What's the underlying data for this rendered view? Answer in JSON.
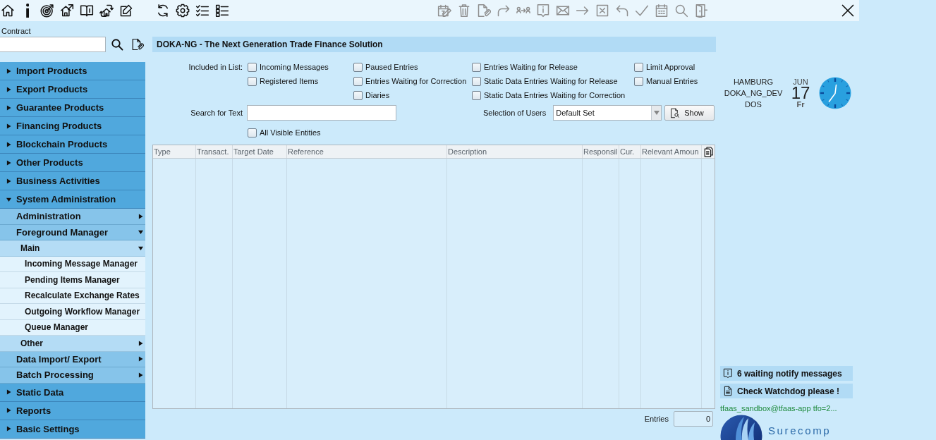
{
  "toolbar": {
    "groups": [
      {
        "buttons": [
          {
            "kind": "home",
            "disabled": false
          },
          {
            "kind": "info",
            "disabled": false
          },
          {
            "kind": "target",
            "disabled": false
          },
          {
            "kind": "export",
            "disabled": false
          },
          {
            "kind": "book",
            "disabled": false
          },
          {
            "kind": "exchange",
            "disabled": false
          },
          {
            "kind": "edit",
            "disabled": false
          }
        ]
      },
      {
        "buttons": [
          {
            "kind": "refresh",
            "disabled": false
          },
          {
            "kind": "settings",
            "disabled": false
          },
          {
            "kind": "checklist",
            "disabled": false
          },
          {
            "kind": "list",
            "disabled": false
          }
        ]
      },
      {
        "buttons": [
          {
            "kind": "diary",
            "disabled": true
          },
          {
            "kind": "delete",
            "disabled": true
          },
          {
            "kind": "attach",
            "disabled": true
          },
          {
            "kind": "forward",
            "disabled": true
          },
          {
            "kind": "transfer",
            "disabled": true
          },
          {
            "kind": "note",
            "disabled": true
          },
          {
            "kind": "mail",
            "disabled": true
          },
          {
            "kind": "send",
            "disabled": true
          },
          {
            "kind": "cancel",
            "disabled": true
          },
          {
            "kind": "reply",
            "disabled": true
          },
          {
            "kind": "approve",
            "disabled": true
          },
          {
            "kind": "calendar",
            "disabled": true
          },
          {
            "kind": "search",
            "disabled": true
          },
          {
            "kind": "exit",
            "disabled": true
          }
        ]
      }
    ],
    "close": {
      "kind": "close",
      "disabled": false
    }
  },
  "contract": {
    "label": "Contract"
  },
  "menu": [
    {
      "label": "Import Products",
      "expanded": false
    },
    {
      "label": "Export Products",
      "expanded": false
    },
    {
      "label": "Guarantee Products",
      "expanded": false
    },
    {
      "label": "Financing Products",
      "expanded": false
    },
    {
      "label": "Blockchain Products",
      "expanded": false
    },
    {
      "label": "Other Products",
      "expanded": false
    },
    {
      "label": "Business Activities",
      "expanded": false
    },
    {
      "label": "System Administration",
      "expanded": true,
      "children": [
        {
          "label": "Administration",
          "expanded": false
        },
        {
          "label": "Foreground Manager",
          "expanded": true,
          "children": [
            {
              "label": "Main",
              "expanded": true,
              "children": [
                {
                  "label": "Incoming Message Manager"
                },
                {
                  "label": "Pending Items Manager"
                },
                {
                  "label": "Recalculate Exchange Rates"
                },
                {
                  "label": "Outgoing Workflow Manager"
                },
                {
                  "label": "Queue Manager"
                }
              ]
            },
            {
              "label": "Other",
              "expanded": false
            }
          ]
        },
        {
          "label": "Data Import/ Export",
          "expanded": false
        },
        {
          "label": "Batch Processing",
          "expanded": false
        }
      ]
    },
    {
      "label": "Static Data",
      "expanded": false
    },
    {
      "label": "Reports",
      "expanded": false
    },
    {
      "label": "Basic Settings",
      "expanded": false
    }
  ],
  "header": {
    "title": "DOKA-NG - The Next Generation Trade Finance Solution"
  },
  "filters": {
    "included_label": "Included in List:",
    "columns": [
      {
        "options": [
          {
            "label": "Incoming Messages",
            "checked": false
          },
          {
            "label": "Registered Items",
            "checked": false
          }
        ]
      },
      {
        "options": [
          {
            "label": "Paused Entries",
            "checked": false
          },
          {
            "label": "Entries Waiting for Correction",
            "checked": false
          },
          {
            "label": "Diaries",
            "checked": false
          }
        ]
      },
      {
        "options": [
          {
            "label": "Entries Waiting for Release",
            "checked": false
          },
          {
            "label": "Static Data Entries Waiting for Release",
            "checked": false
          },
          {
            "label": "Static Data Entries Waiting for Correction",
            "checked": false
          }
        ]
      },
      {
        "options": [
          {
            "label": "Limit Approval",
            "checked": false
          },
          {
            "label": "Manual Entries",
            "checked": false
          }
        ]
      }
    ],
    "search": {
      "label": "Search for Text"
    },
    "users": {
      "label": "Selection of Users",
      "value": "Default Set"
    },
    "show_button": {
      "label": "Show"
    },
    "all_visible": {
      "label": "All Visible Entities",
      "checked": false
    }
  },
  "table": {
    "columns": [
      "Type",
      "Transact.",
      "Target Date",
      "Reference",
      "Description",
      "Responsil",
      "Cur.",
      "Relevant Amoun"
    ]
  },
  "entries": {
    "label": "Entries",
    "value": "0"
  },
  "session": {
    "location": [
      "HAMBURG",
      "DOKA_NG_DEV",
      "DOS"
    ],
    "month": "JUN",
    "day": "17",
    "weekday": "Fr"
  },
  "notifications": [
    {
      "kind": "info",
      "text": "6 waiting notify messages"
    },
    {
      "kind": "document",
      "text": "Check Watchdog please !"
    }
  ],
  "connection": "tfaas_sandbox@tfaas-app tfo=2...",
  "logo": {
    "text": "Surecomp"
  }
}
